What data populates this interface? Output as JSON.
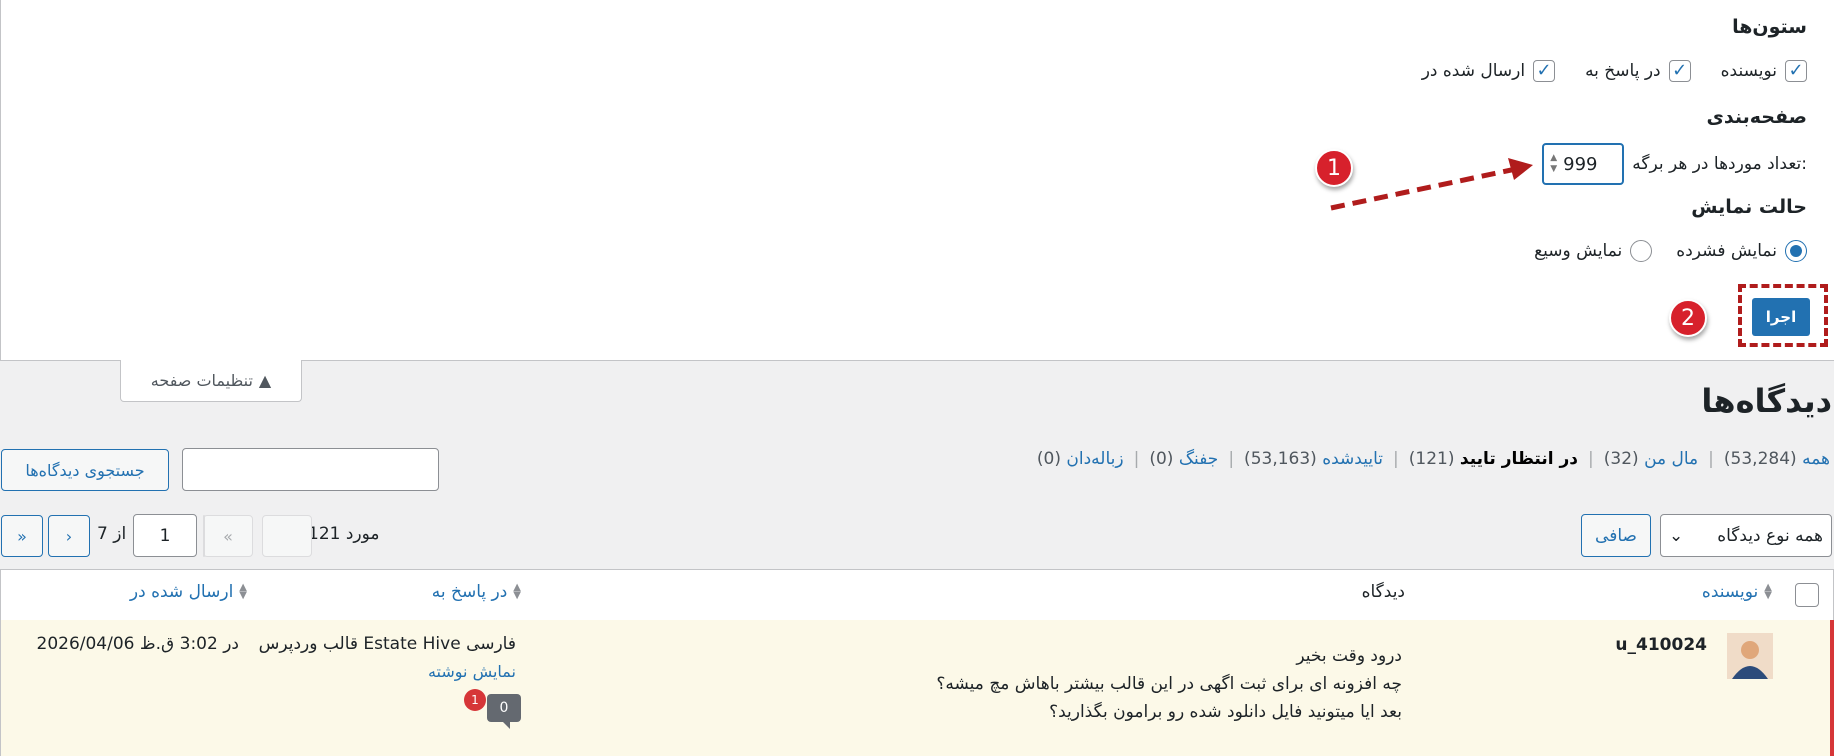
{
  "screen_options": {
    "columns_title": "ستون‌ها",
    "columns": [
      {
        "label": "نویسنده",
        "checked": true
      },
      {
        "label": "در پاسخ به",
        "checked": true
      },
      {
        "label": "ارسال شده در",
        "checked": true
      }
    ],
    "pagination_title": "صفحه‌بندی",
    "per_page_label": "تعداد موردها در هر برگه:",
    "per_page_value": "999",
    "view_mode_title": "حالت نمایش",
    "view_modes": [
      {
        "label": "نمایش فشرده",
        "selected": true
      },
      {
        "label": "نمایش وسیع",
        "selected": false
      }
    ],
    "apply_label": "اجرا",
    "toggle_label": "تنظیمات صفحه"
  },
  "annotations": {
    "badge1": "1",
    "badge2": "2",
    "color": "#d7212c"
  },
  "page": {
    "title": "دیدگاه‌ها",
    "filters": [
      {
        "label": "همه",
        "count": "(53,284)",
        "current": false
      },
      {
        "label": "مال من",
        "count": "(32)",
        "current": false
      },
      {
        "label": "در انتظار تایید",
        "count": "(121)",
        "current": true
      },
      {
        "label": "تاییدشده",
        "count": "(53,163)",
        "current": false
      },
      {
        "label": "جفنگ",
        "count": "(0)",
        "current": false
      },
      {
        "label": "زباله‌دان",
        "count": "(0)",
        "current": false
      }
    ],
    "search_button": "جستجوی دیدگاه‌ها",
    "search_value": "",
    "bulk_select": "همه نوع دیدگاه",
    "filter_button": "صافی",
    "items_count": "121 مورد",
    "pager": {
      "first": "«",
      "prev": "‹",
      "current": "1",
      "of": "از 7",
      "next": "›",
      "last": "»"
    }
  },
  "table": {
    "headers": {
      "author": "نویسنده",
      "comment": "دیدگاه",
      "response": "در پاسخ به",
      "submitted": "ارسال شده در"
    },
    "rows": [
      {
        "author": "u_410024",
        "comment_lines": [
          "درود وقت بخیر",
          "چه افزونه ای برای ثبت اگهی در این قالب بیشتر باهاش مچ میشه؟",
          "بعد ایا میتونید فایل دانلود شده رو برامون بگذارید؟"
        ],
        "response_title": "قالب وردپرس Estate Hive فارسی",
        "view_post": "نمایش نوشته",
        "comment_count": "0",
        "pending_count": "1",
        "submitted": "2026/04/06 در 3:02 ق.ظ"
      }
    ]
  },
  "colors": {
    "accent": "#2271b1",
    "pending_row": "#fcf9e8",
    "alert": "#d63638"
  }
}
